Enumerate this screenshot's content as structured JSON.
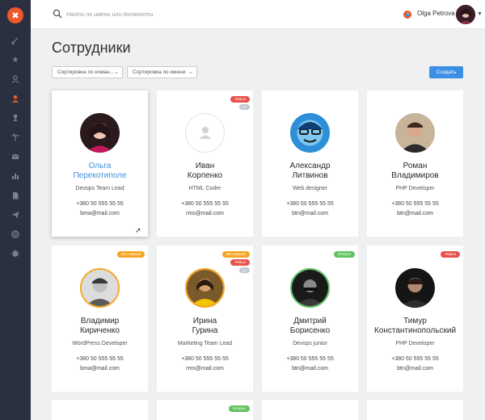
{
  "search": {
    "placeholder": "Найти по имени или должности"
  },
  "user": {
    "name": "Olga Petrova"
  },
  "page": {
    "title": "Сотрудники"
  },
  "controls": {
    "sort_command": "Сортировка по коман...",
    "sort_name": "Сортировка по имени",
    "create_label": "Создать"
  },
  "colors": {
    "accent": "#3d8fe3",
    "brand": "#f0582a",
    "sidebar": "#2b3040"
  },
  "employees": [
    {
      "first": "Ольга",
      "last": "Перекотиполе",
      "role": "Devops Team Lead",
      "phone": "+380 50 555 55 55",
      "email": "bma@mail.com",
      "badge": "",
      "count": ""
    },
    {
      "first": "Иван",
      "last": "Корпенко",
      "role": "HTML Coder",
      "phone": "+380 50 555 55 55",
      "email": "rms@mail.com",
      "badge": "Ревью",
      "count": "17"
    },
    {
      "first": "Александр",
      "last": "Литвинов",
      "role": "Web designer",
      "phone": "+380 50 555 55 55",
      "email": "btn@mail.com",
      "badge": "",
      "count": ""
    },
    {
      "first": "Роман",
      "last": "Владимиров",
      "role": "PHP Developer",
      "phone": "+380 50 555 55 55",
      "email": "btn@mail.com",
      "badge": "",
      "count": ""
    },
    {
      "first": "Владимир",
      "last": "Кириченко",
      "role": "WordPress Developer",
      "phone": "+380 50 555 55 55",
      "email": "bma@mail.com",
      "badge": "Исп.период",
      "count": ""
    },
    {
      "first": "Ирина",
      "last": "Гурина",
      "role": "Marketing Team Lead",
      "phone": "+380 50 555 55 55",
      "email": "rms@mail.com",
      "badge": "Исп.период",
      "badge2": "Ревью",
      "count": "17"
    },
    {
      "first": "Дмитрий",
      "last": "Борисенко",
      "role": "Devops junior",
      "phone": "+380 50 555 55 55",
      "email": "btn@mail.com",
      "badge": "Отпуск",
      "count": ""
    },
    {
      "first": "Тимур",
      "last": "Константинопольский",
      "role": "PHP Developer",
      "phone": "+380 50 555 55 55",
      "email": "btn@mail.com",
      "badge": "Ревью",
      "count": ""
    }
  ],
  "third_row": {
    "badge": "Отпуск"
  }
}
